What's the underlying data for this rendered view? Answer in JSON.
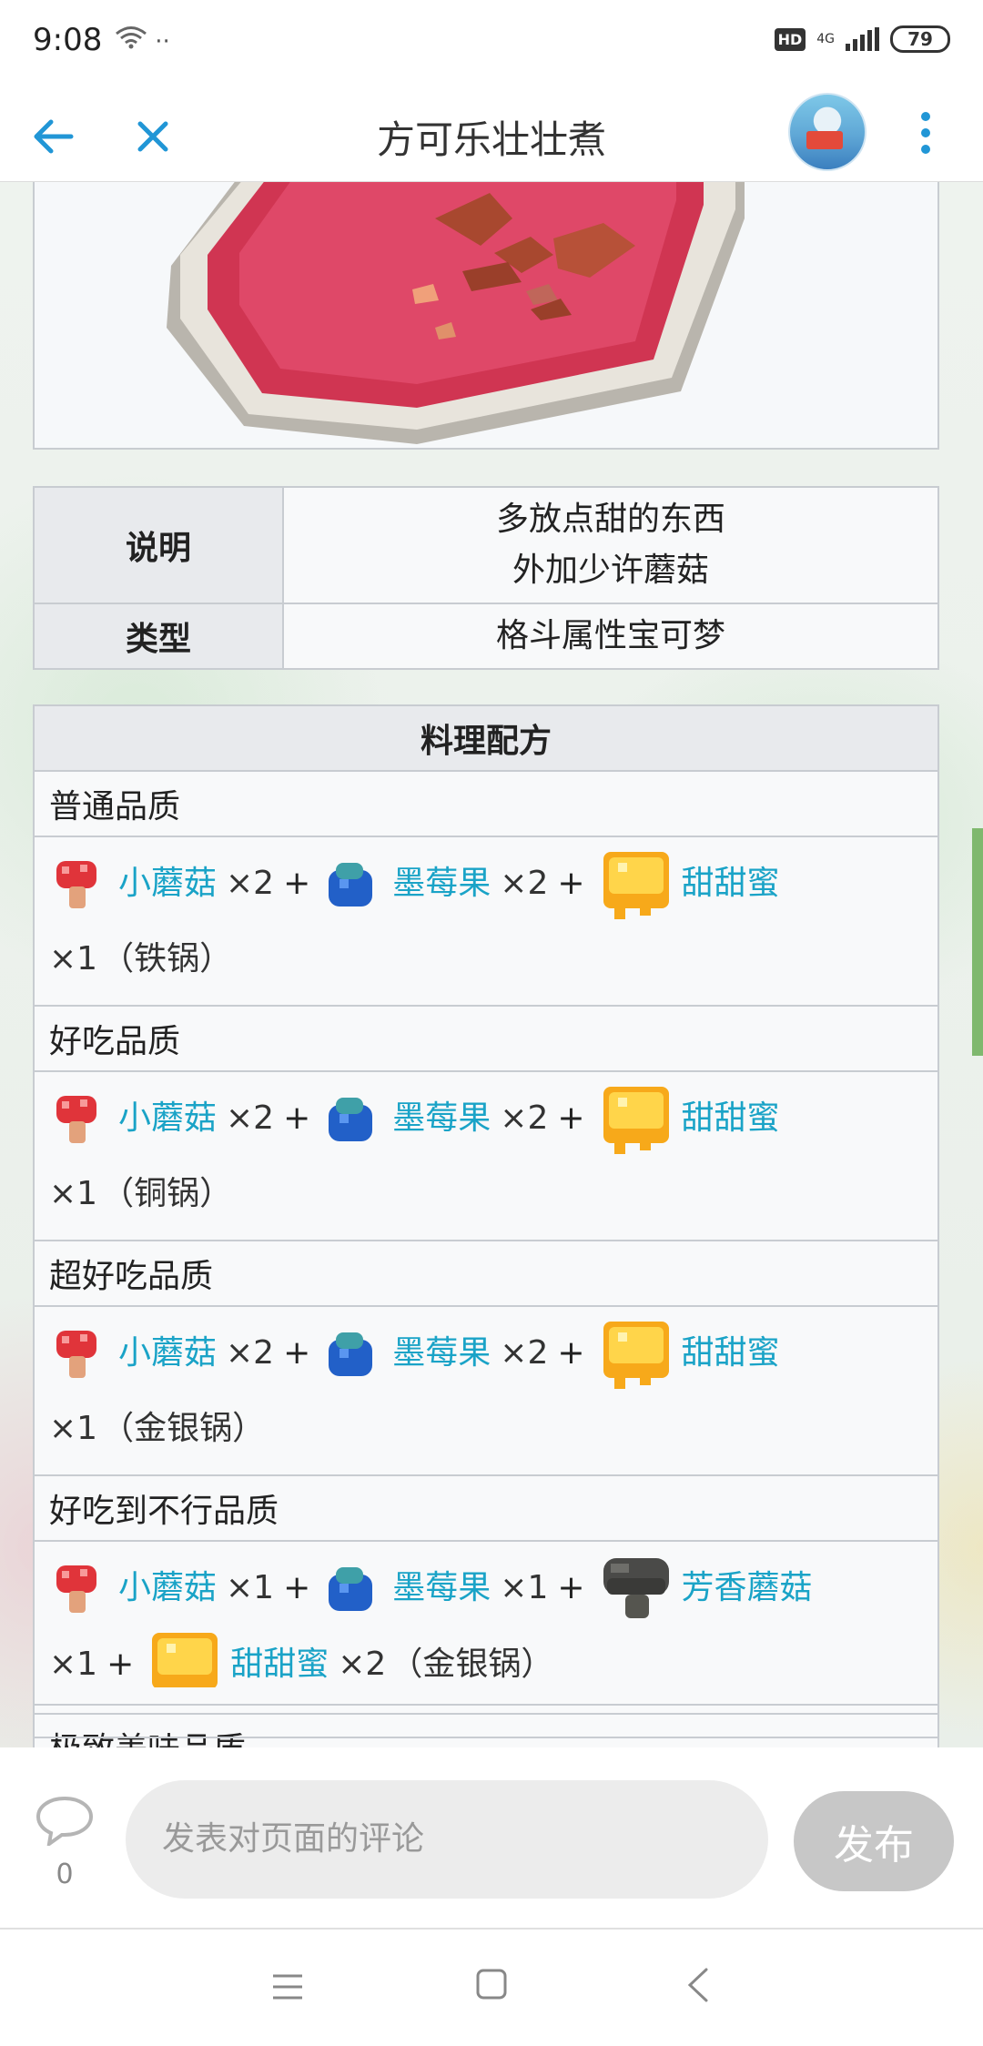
{
  "status_bar": {
    "time": "9:08",
    "left_icons": "··",
    "hd": "HD",
    "network": "4G",
    "battery": "79"
  },
  "header": {
    "title": "方可乐壮壮煮"
  },
  "info_table": {
    "rows": [
      {
        "label": "说明",
        "value_line1": "多放点甜的东西",
        "value_line2": "外加少许蘑菇"
      },
      {
        "label": "类型",
        "value": "格斗属性宝可梦"
      }
    ]
  },
  "recipe": {
    "title": "料理配方",
    "qualities": [
      {
        "name": "普通品质",
        "ingredients": [
          {
            "name": "小蘑菇",
            "qty": "×2",
            "icon": "red-mushroom-icon"
          },
          {
            "name": "墨莓果",
            "qty": "×2",
            "icon": "blue-berry-icon"
          },
          {
            "name": "甜甜蜜",
            "qty": "×1",
            "icon": "honey-icon"
          }
        ],
        "pot": "（铁锅）"
      },
      {
        "name": "好吃品质",
        "ingredients": [
          {
            "name": "小蘑菇",
            "qty": "×2",
            "icon": "red-mushroom-icon"
          },
          {
            "name": "墨莓果",
            "qty": "×2",
            "icon": "blue-berry-icon"
          },
          {
            "name": "甜甜蜜",
            "qty": "×1",
            "icon": "honey-icon"
          }
        ],
        "pot": "（铜锅）"
      },
      {
        "name": "超好吃品质",
        "ingredients": [
          {
            "name": "小蘑菇",
            "qty": "×2",
            "icon": "red-mushroom-icon"
          },
          {
            "name": "墨莓果",
            "qty": "×2",
            "icon": "blue-berry-icon"
          },
          {
            "name": "甜甜蜜",
            "qty": "×1",
            "icon": "honey-icon"
          }
        ],
        "pot": "（金银锅）"
      },
      {
        "name": "好吃到不行品质",
        "ingredients": [
          {
            "name": "小蘑菇",
            "qty": "×1",
            "icon": "red-mushroom-icon"
          },
          {
            "name": "墨莓果",
            "qty": "×1",
            "icon": "blue-berry-icon"
          },
          {
            "name": "芳香蘑菇",
            "qty": "×1",
            "icon": "aromatic-mushroom-icon"
          },
          {
            "name": "甜甜蜜",
            "qty": "×2",
            "icon": "honey-icon"
          }
        ],
        "pot": "（金银锅）"
      },
      {
        "name": "极致美味品质"
      }
    ]
  },
  "symbols": {
    "plus": "+"
  },
  "comment_bar": {
    "count": "0",
    "placeholder": "发表对页面的评论",
    "publish_label": "发布"
  },
  "colors": {
    "link": "#1aa3c7",
    "accent": "#2196d6",
    "table_border": "#c8ccd1",
    "header_cell": "#e8eaed"
  }
}
